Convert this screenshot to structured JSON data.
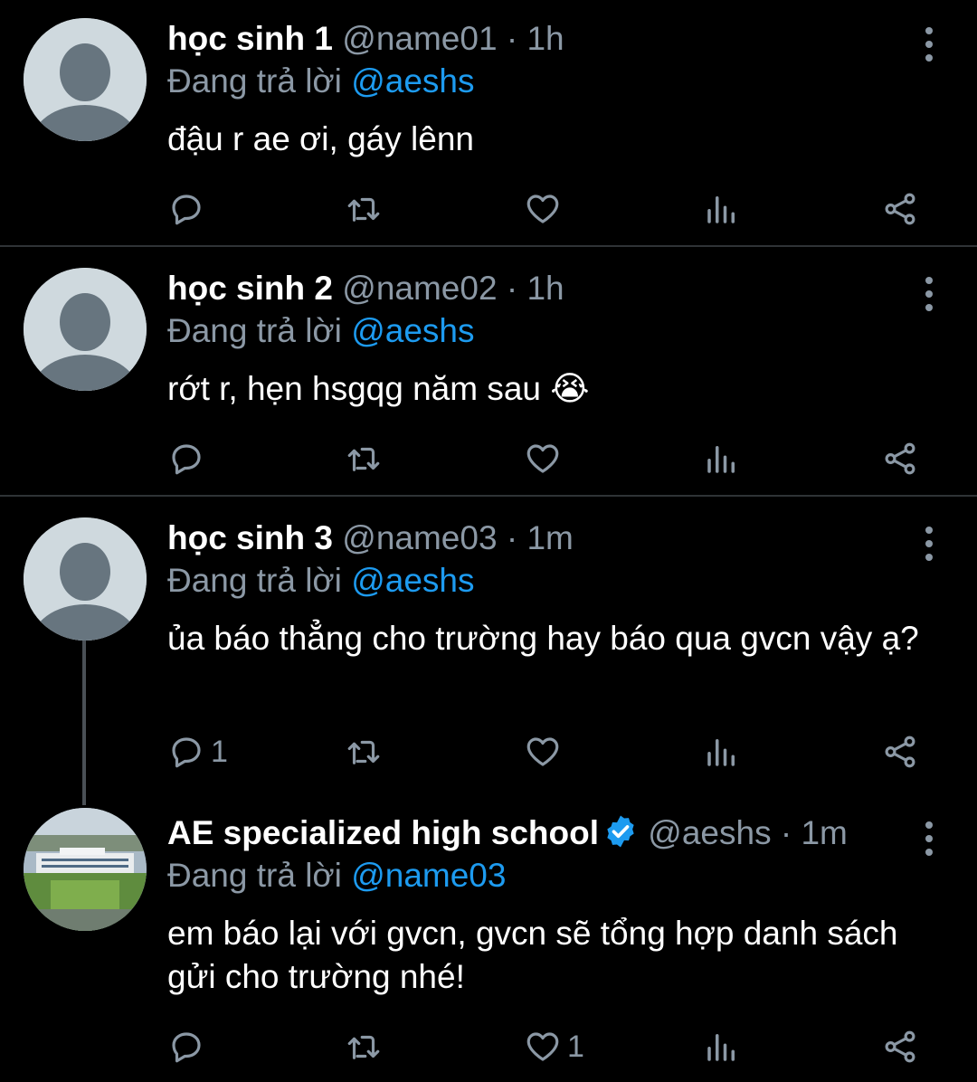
{
  "tweets": [
    {
      "name": "học sinh 1",
      "handle": "@name01",
      "dot": "·",
      "time": "1h",
      "reply_prefix": "Đang trả lời",
      "reply_to": "@aeshs",
      "text": "đậu r ae ơi, gáy lênn",
      "reply_count": "",
      "like_count": ""
    },
    {
      "name": "học sinh 2",
      "handle": "@name02",
      "dot": "·",
      "time": "1h",
      "reply_prefix": "Đang trả lời",
      "reply_to": "@aeshs",
      "text": "rớt r, hẹn hsgqg năm sau 😭",
      "reply_count": "",
      "like_count": ""
    },
    {
      "name": "học sinh 3",
      "handle": "@name03",
      "dot": "·",
      "time": "1m",
      "reply_prefix": "Đang trả lời",
      "reply_to": "@aeshs",
      "text": "ủa báo thẳng cho trường hay báo qua gvcn vậy ạ?",
      "reply_count": "1",
      "like_count": ""
    },
    {
      "name": "AE specialized high school",
      "handle": "@aeshs",
      "dot": "·",
      "time": "1m",
      "reply_prefix": "Đang trả lời",
      "reply_to": "@name03",
      "text": "em báo lại với gvcn, gvcn sẽ tổng hợp danh sách gửi cho trường nhé!",
      "reply_count": "",
      "like_count": "1"
    }
  ],
  "icons": {
    "reply": "reply-icon",
    "retweet": "retweet-icon",
    "like": "heart-icon",
    "views": "views-icon",
    "share": "share-icon",
    "more": "more-vertical-icon",
    "verified": "verified-badge-icon"
  },
  "colors": {
    "background": "#000000",
    "mention": "#1d9bf0",
    "muted": "#8b98a5",
    "verified": "#1d9bf0"
  }
}
